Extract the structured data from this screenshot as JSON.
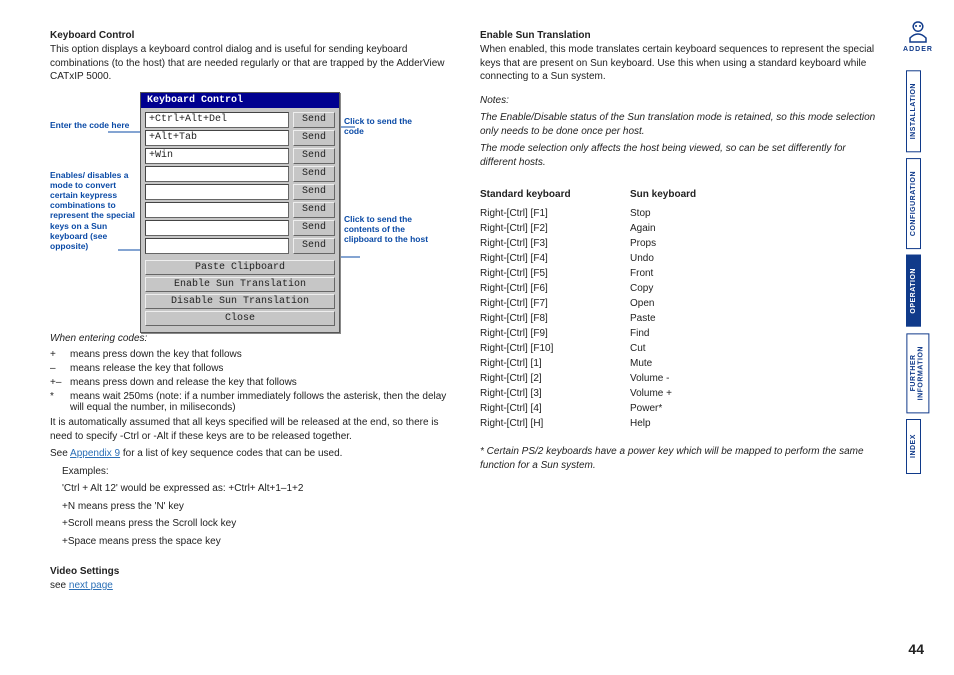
{
  "left": {
    "h1": "Keyboard Control",
    "p1": "This option displays a keyboard control dialog and is useful for sending keyboard combinations (to the host) that are needed regularly or that are trapped by the AdderView CATxIP 5000.",
    "annLeft1": "Enter the code here",
    "annLeft2": "Enables/ disables a mode to convert certain keypress combinations to represent the special keys on a Sun keyboard (see opposite)",
    "annRight1": "Click to send the code",
    "annRight2": "Click to send the contents of the clipboard to the host",
    "dialog": {
      "title": "Keyboard Control",
      "rows": [
        "+Ctrl+Alt+Del",
        "+Alt+Tab",
        "+Win",
        "",
        "",
        "",
        "",
        ""
      ],
      "send": "Send",
      "paste": "Paste Clipboard",
      "enableSun": "Enable Sun Translation",
      "disableSun": "Disable Sun Translation",
      "close": "Close"
    },
    "whenHeading": "When entering codes:",
    "codes": [
      {
        "sym": "+",
        "txt": "means press down the key that follows"
      },
      {
        "sym": "–",
        "txt": "means release the key that follows"
      },
      {
        "sym": "+–",
        "txt": "means press down and release the key that follows"
      },
      {
        "sym": "*",
        "txt": "means wait 250ms (note: if a number immediately follows the asterisk, then the delay will equal the number, in miliseconds)"
      }
    ],
    "autoRelease": "It is automatically assumed that all keys specified will be released at the end, so there is need to specify -Ctrl or -Alt if these keys are to be released together.",
    "seePrefix": "See ",
    "appendixLink": "Appendix 9",
    "seeSuffix": " for a list of key sequence codes that can be used.",
    "examplesLabel": "Examples:",
    "ex1": "'Ctrl + Alt 12' would be expressed as: +Ctrl+ Alt+1–1+2",
    "ex2": "+N means press the 'N' key",
    "ex3": "+Scroll means press the Scroll lock key",
    "ex4": "+Space means press the space key",
    "videoHeading": "Video Settings",
    "videoSeePrefix": "see ",
    "videoLink": "next page"
  },
  "right": {
    "h1": "Enable Sun Translation",
    "p1": "When enabled, this mode translates certain keyboard sequences to represent the special keys that are present on Sun keyboard. Use this when using a standard keyboard while connecting to a Sun system.",
    "notesLabel": "Notes:",
    "note1": "The Enable/Disable status of the Sun translation mode is retained, so this mode selection only needs to be done once per host.",
    "note2": "The mode selection only affects the host being viewed, so can be set differently for different hosts.",
    "tblHead1": "Standard keyboard",
    "tblHead2": "Sun keyboard",
    "rows": [
      [
        "Right-[Ctrl] [F1]",
        "Stop"
      ],
      [
        "Right-[Ctrl] [F2]",
        "Again"
      ],
      [
        "Right-[Ctrl] [F3]",
        "Props"
      ],
      [
        "Right-[Ctrl] [F4]",
        "Undo"
      ],
      [
        "Right-[Ctrl] [F5]",
        "Front"
      ],
      [
        "Right-[Ctrl] [F6]",
        "Copy"
      ],
      [
        "Right-[Ctrl] [F7]",
        "Open"
      ],
      [
        "Right-[Ctrl] [F8]",
        "Paste"
      ],
      [
        "Right-[Ctrl] [F9]",
        "Find"
      ],
      [
        "Right-[Ctrl] [F10]",
        "Cut"
      ],
      [
        "Right-[Ctrl] [1]",
        "Mute"
      ],
      [
        "Right-[Ctrl] [2]",
        "Volume -"
      ],
      [
        "Right-[Ctrl] [3]",
        "Volume +"
      ],
      [
        "Right-[Ctrl] [4]",
        "Power*"
      ],
      [
        "Right-[Ctrl] [H]",
        "Help"
      ]
    ],
    "footnote": "* Certain PS/2 keyboards have a power key which will be mapped to perform the same function for a Sun system."
  },
  "nav": {
    "brand": "ADDER",
    "items": [
      "INSTALLATION",
      "CONFIGURATION",
      "OPERATION",
      "FURTHER\nINFORMATION",
      "INDEX"
    ],
    "activeIndex": 2
  },
  "pageNum": "44"
}
